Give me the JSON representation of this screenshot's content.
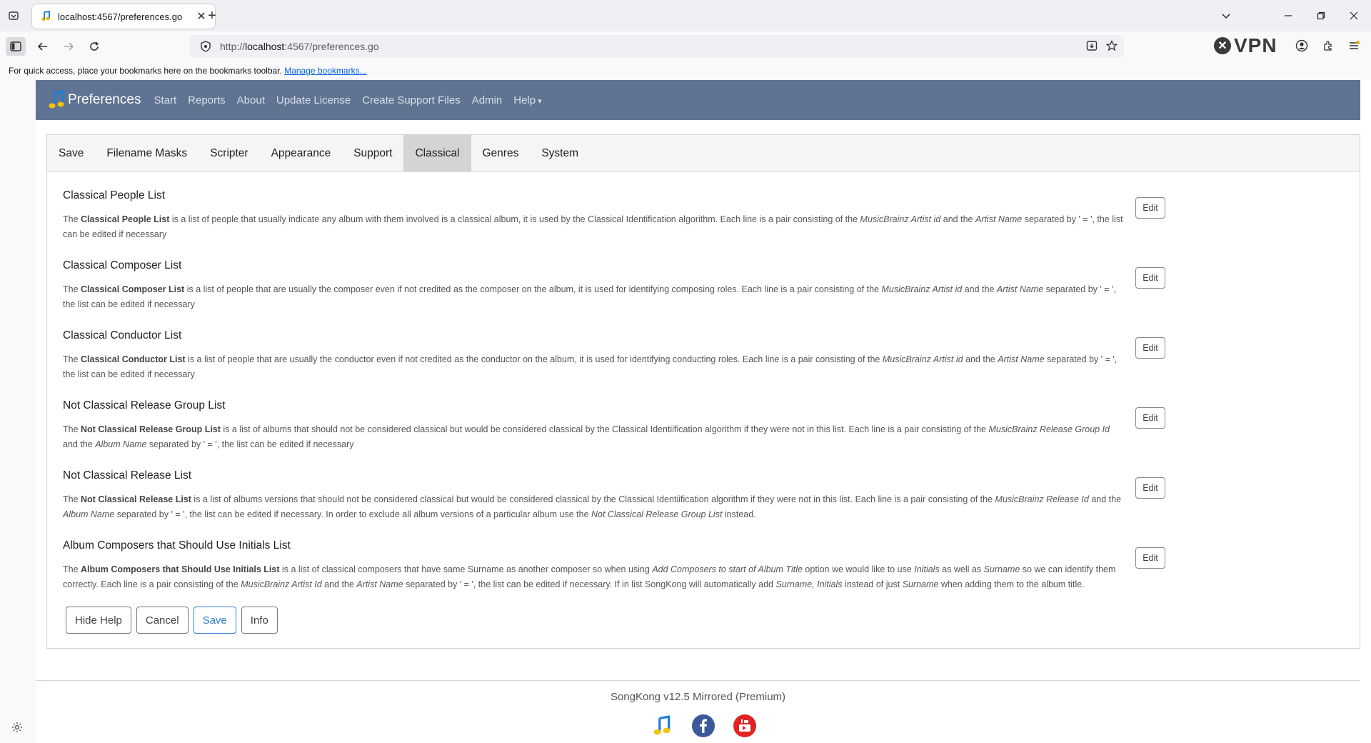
{
  "browser": {
    "tab_title": "localhost:4567/preferences.go",
    "url_prefix": "http://",
    "url_host": "localhost",
    "url_rest": ":4567/preferences.go",
    "vpn_label": "VPN",
    "bookmarks_text": "For quick access, place your bookmarks here on the bookmarks toolbar.",
    "bookmarks_link": "Manage bookmarks..."
  },
  "header": {
    "brand": "Preferences",
    "menu": [
      "Start",
      "Reports",
      "About",
      "Update License",
      "Create Support Files",
      "Admin",
      "Help"
    ]
  },
  "tabs": [
    "Save",
    "Filename Masks",
    "Scripter",
    "Appearance",
    "Support",
    "Classical",
    "Genres",
    "System"
  ],
  "active_tab": "Classical",
  "edit_label": "Edit",
  "sections": [
    {
      "title": "Classical People List"
    },
    {
      "title": "Classical Composer List"
    },
    {
      "title": "Classical Conductor List"
    },
    {
      "title": "Not Classical Release Group List"
    },
    {
      "title": "Not Classical Release List"
    },
    {
      "title": "Album Composers that Should Use Initials List"
    }
  ],
  "descriptions": {
    "s0": {
      "a": "The ",
      "b": "Classical People List",
      "c": " is a list of people that usually indicate any album with them involved is a classical album, it is used by the Classical Identification algorithm. Each line is a pair consisting of the ",
      "d": "MusicBrainz Artist id",
      "e": " and the ",
      "f": "Artist Name",
      "g": " separated by ' = ', the list can be edited if necessary"
    },
    "s1": {
      "a": "The ",
      "b": "Classical Composer List",
      "c": " is a list of people that are usually the composer even if not credited as the composer on the album, it is used for identifying composing roles. Each line is a pair consisting of the ",
      "d": "MusicBrainz Artist id",
      "e": " and the ",
      "f": "Artist Name",
      "g": " separated by ' = ', the list can be edited if necessary"
    },
    "s2": {
      "a": "The ",
      "b": "Classical Conductor List",
      "c": " is a list of people that are usually the conductor even if not credited as the conductor on the album, it is used for identifying conducting roles. Each line is a pair consisting of the ",
      "d": "MusicBrainz Artist id",
      "e": " and the ",
      "f": "Artist Name",
      "g": " separated by ' = ', the list can be edited if necessary"
    },
    "s3": {
      "a": "The ",
      "b": "Not Classical Release Group List",
      "c": " is a list of albums that should not be considered classical but would be considered classical by the Classical Identiification algorithm if they were not in this list. Each line is a pair consisting of the ",
      "d": "MusicBrainz Release Group Id",
      "e": " and the ",
      "f": "Album Name",
      "g": " separated by ' = ', the list can be edited if necessary"
    },
    "s4": {
      "a": "The ",
      "b": "Not Classical Release List",
      "c": " is a list of albums versions that should not be considered classical but would be considered classical by the Classical Identiification algorithm if they were not in this list. Each line is a pair consisting of the ",
      "d": "MusicBrainz Release Id",
      "e": " and the ",
      "f": "Album Name",
      "g": " separated by ' = ', the list can be edited if necessary. In order to exclude all album versions of a particular album use the ",
      "h": "Not Classical Release Group List",
      "i": " instead."
    },
    "s5": {
      "a": "The ",
      "b": "Album Composers that Should Use Initials List",
      "c": " is a list of classical composers that have same Surname as another composer so when using ",
      "d": "Add Composers to start of Album Title",
      "e": " option we would like to use ",
      "f": "Initials",
      "g": " as well as ",
      "h": "Surname",
      "i": " so we can identify them correctly. Each line is a pair consisting of the ",
      "j": "MusicBrainz Artist Id",
      "k": " and the ",
      "l": "Artist Name",
      "m": " separated by ' = ', the list can be edited if necessary. If in list SongKong will automatically add ",
      "n": "Surname, Initials",
      "o": " instead of just ",
      "p": "Surname",
      "q": " when adding them to the album title."
    }
  },
  "actions": [
    "Hide Help",
    "Cancel",
    "Save",
    "Info"
  ],
  "footer": {
    "version": "SongKong v12.5 Mirrored (Premium)"
  },
  "colors": {
    "header_bg": "#5f7492",
    "primary": "#2f7fd8",
    "facebook": "#3b5998",
    "youtube": "#e02424"
  }
}
